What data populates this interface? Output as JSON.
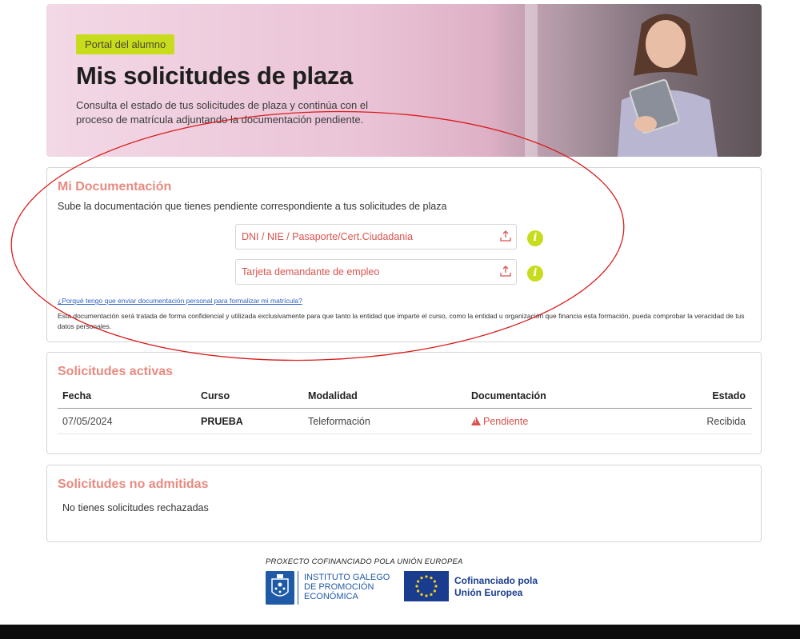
{
  "hero": {
    "badge": "Portal del alumno",
    "title": "Mis solicitudes de plaza",
    "subtitle": "Consulta el estado de tus solicitudes de plaza y continúa con el proceso de matrícula adjuntando la documentación pendiente."
  },
  "documentation": {
    "title": "Mi Documentación",
    "description": "Sube la documentación que tienes pendiente correspondiente a tus solicitudes de plaza",
    "uploads": [
      {
        "label": "DNI / NIE / Pasaporte/Cert.Ciudadania",
        "icon": "upload-icon",
        "info_icon": "info-icon"
      },
      {
        "label": "Tarjeta demandante de empleo",
        "icon": "upload-icon",
        "info_icon": "info-icon"
      }
    ],
    "why_link": "¿Porqué tengo que enviar documentación personal para formalizar mi matrícula?",
    "legal_text": "Esta documentación será tratada de forma confidencial y utilizada exclusivamente para que tanto la entidad que imparte el curso, como la entidad u organización que financia esta formación, pueda comprobar la veracidad de tus datos personales."
  },
  "active_requests": {
    "title": "Solicitudes activas",
    "columns": [
      "Fecha",
      "Curso",
      "Modalidad",
      "Documentación",
      "Estado"
    ],
    "rows": [
      {
        "fecha": "07/05/2024",
        "curso": "PRUEBA",
        "modalidad": "Teleformación",
        "documentacion": "Pendiente",
        "estado": "Recibida"
      }
    ]
  },
  "rejected_requests": {
    "title": "Solicitudes no admitidas",
    "empty_text": "No tienes solicitudes rechazadas"
  },
  "footer": {
    "cofinance_header": "PROXECTO COFINANCIADO POLA UNIÓN EUROPEA",
    "igape_line1": "INSTITUTO GALEGO",
    "igape_line2": "DE PROMOCIÓN",
    "igape_line3": "ECONÓMICA",
    "eu_line1": "Cofinanciado pola",
    "eu_line2": "Unión Europea"
  },
  "colors": {
    "accent_lime": "#c8dc1e",
    "title_salmon": "#e88a80",
    "alert_red": "#d9534f",
    "annotation_red": "#d81e1e",
    "igape_blue": "#1f5aa6",
    "eu_blue": "#1a3c8f"
  }
}
